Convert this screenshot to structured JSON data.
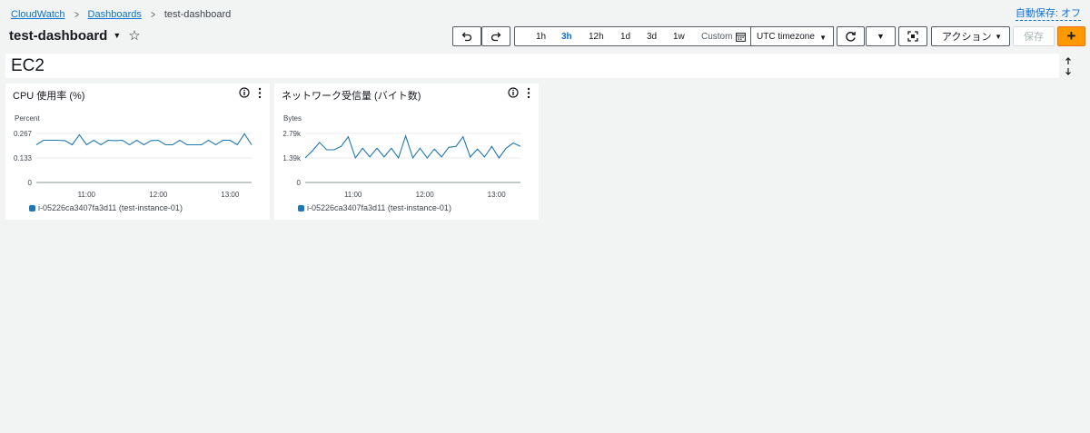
{
  "breadcrumb": {
    "root": "CloudWatch",
    "parent": "Dashboards",
    "current": "test-dashboard"
  },
  "autosave_label": "自動保存: オフ",
  "dashboard": {
    "title": "test-dashboard"
  },
  "toolbar": {
    "ranges": [
      {
        "label": "1h",
        "active": false
      },
      {
        "label": "3h",
        "active": true
      },
      {
        "label": "12h",
        "active": false
      },
      {
        "label": "1d",
        "active": false
      },
      {
        "label": "3d",
        "active": false
      },
      {
        "label": "1w",
        "active": false
      }
    ],
    "custom_label": "Custom",
    "timezone_label": "UTC timezone",
    "actions_label": "アクション",
    "save_label": "保存",
    "add_label": "+"
  },
  "section": {
    "title": "EC2"
  },
  "colors": {
    "accent": "#ff9900",
    "link": "#0972d3",
    "series": "#1f78b4"
  },
  "widgets": [
    {
      "title": "CPU 使用率 (%)",
      "unit": "Percent",
      "legend": "i-05226ca3407fa3d11 (test-instance-01)",
      "chart_data": {
        "type": "line",
        "ylabel": "Percent",
        "ylim": [
          0,
          0.267
        ],
        "yticks": [
          0,
          0.133,
          0.267
        ],
        "ytick_labels": [
          "0",
          "0.133",
          "0.267"
        ],
        "xticks": [
          60,
          120,
          180
        ],
        "xtick_labels": [
          "11:00",
          "12:00",
          "13:00"
        ],
        "xlim": [
          18,
          198
        ],
        "series": [
          {
            "name": "i-05226ca3407fa3d11 (test-instance-01)",
            "x": [
              18,
              24,
              30,
              36,
              42,
              48,
              54,
              60,
              66,
              72,
              78,
              84,
              90,
              96,
              102,
              108,
              114,
              120,
              126,
              132,
              138,
              144,
              150,
              156,
              162,
              168,
              174,
              180,
              186,
              192,
              198
            ],
            "y": [
              0.205,
              0.23,
              0.23,
              0.23,
              0.228,
              0.205,
              0.26,
              0.205,
              0.23,
              0.205,
              0.23,
              0.228,
              0.23,
              0.205,
              0.23,
              0.205,
              0.228,
              0.23,
              0.205,
              0.205,
              0.23,
              0.205,
              0.205,
              0.205,
              0.23,
              0.205,
              0.23,
              0.23,
              0.205,
              0.265,
              0.205
            ]
          }
        ]
      }
    },
    {
      "title": "ネットワーク受信量 (バイト数)",
      "unit": "Bytes",
      "legend": "i-05226ca3407fa3d11 (test-instance-01)",
      "chart_data": {
        "type": "line",
        "ylabel": "Bytes",
        "ylim": [
          0,
          2790
        ],
        "yticks": [
          0,
          1395,
          2790
        ],
        "ytick_labels": [
          "0",
          "1.39k",
          "2.79k"
        ],
        "xticks": [
          60,
          120,
          180
        ],
        "xtick_labels": [
          "11:00",
          "12:00",
          "13:00"
        ],
        "xlim": [
          20,
          200
        ],
        "series": [
          {
            "name": "i-05226ca3407fa3d11 (test-instance-01)",
            "x": [
              20,
              26,
              32,
              38,
              44,
              50,
              56,
              62,
              68,
              74,
              80,
              86,
              92,
              98,
              104,
              110,
              116,
              122,
              128,
              134,
              140,
              146,
              152,
              158,
              164,
              170,
              176,
              182,
              188,
              194,
              200
            ],
            "y": [
              1395,
              1800,
              2280,
              1860,
              1860,
              2050,
              2600,
              1395,
              1950,
              1450,
              1950,
              1450,
              1950,
              1395,
              2650,
              1395,
              1950,
              1395,
              1900,
              1450,
              2000,
              2050,
              2600,
              1450,
              1900,
              1450,
              2050,
              1395,
              1950,
              2250,
              2050
            ]
          }
        ]
      }
    }
  ]
}
